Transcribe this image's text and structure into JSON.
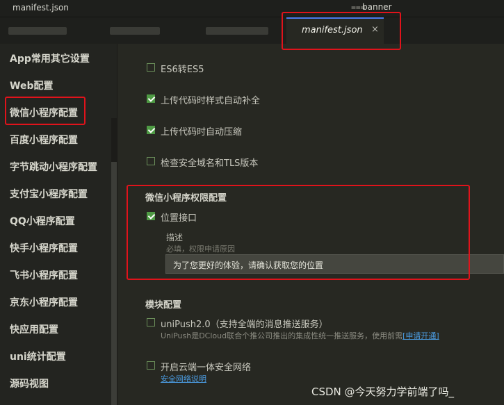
{
  "window": {
    "title": "manifest.json",
    "search_text": "banner",
    "search_icon": "search-list-icon"
  },
  "tabs": {
    "active": {
      "label": "manifest.json",
      "close": "×"
    }
  },
  "sidebar": {
    "items": [
      {
        "label": "App常用其它设置"
      },
      {
        "label": "Web配置"
      },
      {
        "label": "微信小程序配置"
      },
      {
        "label": "百度小程序配置"
      },
      {
        "label": "字节跳动小程序配置"
      },
      {
        "label": "支付宝小程序配置"
      },
      {
        "label": "QQ小程序配置"
      },
      {
        "label": "快手小程序配置"
      },
      {
        "label": "飞书小程序配置"
      },
      {
        "label": "京东小程序配置"
      },
      {
        "label": "快应用配置"
      },
      {
        "label": "uni统计配置"
      },
      {
        "label": "源码视图"
      }
    ]
  },
  "settings": {
    "es6": {
      "label": "ES6转ES5",
      "checked": false
    },
    "postcss": {
      "label": "上传代码时样式自动补全",
      "checked": true
    },
    "minify": {
      "label": "上传代码时自动压缩",
      "checked": true
    },
    "domain_check": {
      "label": "检查安全域名和TLS版本",
      "checked": false
    }
  },
  "permission": {
    "title": "微信小程序权限配置",
    "location": {
      "label": "位置接口",
      "checked": true
    },
    "desc_label": "描述",
    "hint": "必填，权限申请原因",
    "desc_value": "为了您更好的体验，请确认获取您的位置"
  },
  "modules": {
    "title": "模块配置",
    "unipush": {
      "label": "uniPush2.0（支持全端的消息推送服务）",
      "checked": false,
      "desc": "UniPush是DCloud联合个推公司推出的集成性统一推送服务，使用前需",
      "link": "[申请开通]"
    },
    "cloud": {
      "label": "开启云端一体安全网络",
      "checked": false,
      "link": "安全网络说明"
    }
  },
  "watermark": "CSDN @今天努力学前端了吗_",
  "colors": {
    "accent_check": "#4e9a44",
    "highlight": "#e0131b",
    "link": "#4b9be0"
  }
}
